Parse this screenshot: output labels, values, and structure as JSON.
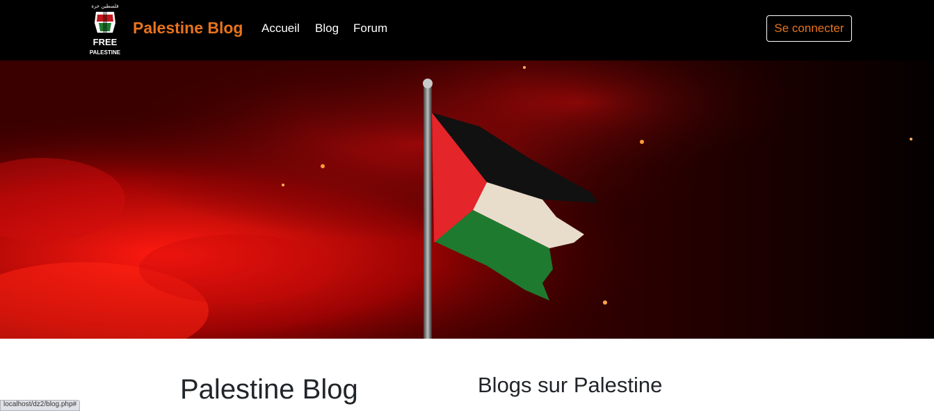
{
  "navbar": {
    "logo": {
      "arabic_text": "فلسطين حرة",
      "line1": "FREE",
      "line2": "PALESTINE"
    },
    "brand": "Palestine Blog",
    "links": [
      "Accueil",
      "Blog",
      "Forum"
    ],
    "login_button": "Se connecter"
  },
  "hero": {
    "image": "palestine-flag-on-red-smoke"
  },
  "main": {
    "left_heading": "Palestine Blog",
    "right_heading": "Blogs sur Palestine"
  },
  "status_bar": {
    "url": "localhost/dz2/blog.php#"
  },
  "colors": {
    "navbar_bg": "#000000",
    "brand": "#e8731c",
    "flag_red": "#e4252a",
    "flag_green": "#1e7a2e",
    "flag_white": "#e8dccb",
    "flag_black": "#111111"
  }
}
